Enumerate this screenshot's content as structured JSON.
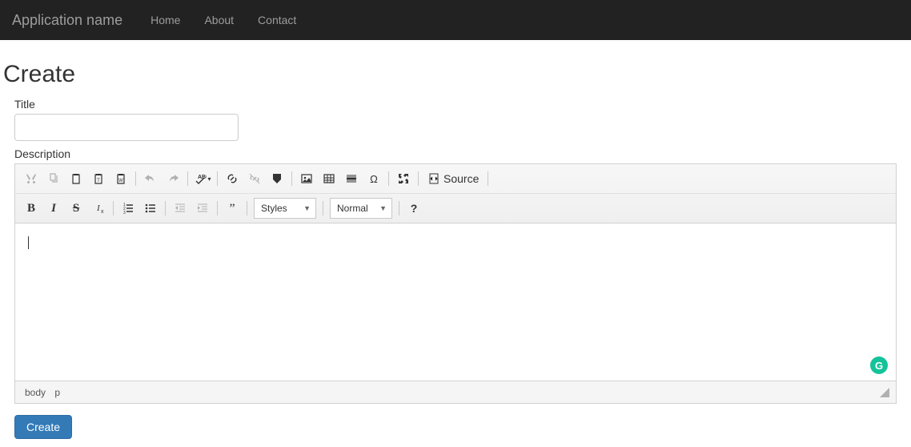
{
  "navbar": {
    "brand": "Application name",
    "links": {
      "home": "Home",
      "about": "About",
      "contact": "Contact"
    }
  },
  "page": {
    "heading": "Create",
    "title_label": "Title",
    "title_value": "",
    "desc_label": "Description",
    "create_button": "Create"
  },
  "editor": {
    "source_label": "Source",
    "styles_combo": "Styles",
    "format_combo": "Normal",
    "path": {
      "body": "body",
      "p": "p"
    },
    "grammarly": "G"
  }
}
